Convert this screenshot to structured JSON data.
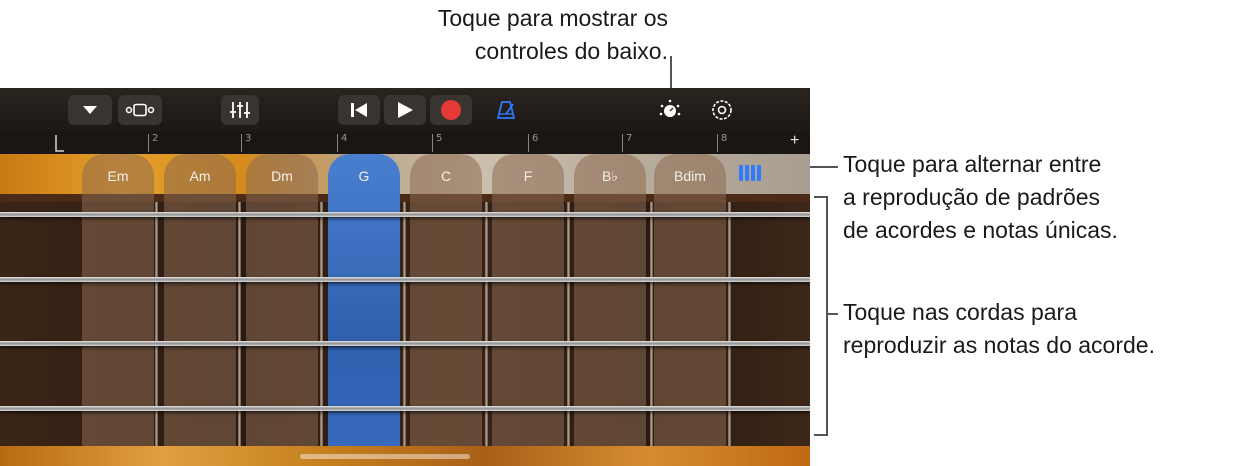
{
  "callouts": {
    "top": [
      "Toque para mostrar os",
      "controles do baixo."
    ],
    "mode": [
      "Toque para alternar entre",
      "a reprodução de padrões",
      "de acordes e notas únicas."
    ],
    "strings": [
      "Toque nas cordas para",
      "reproduzir as notas do acorde."
    ]
  },
  "toolbar": {
    "icons": [
      "dropdown-icon",
      "view-toggle-icon",
      "mixer-icon",
      "go-to-start-icon",
      "play-icon",
      "record-icon",
      "metronome-icon",
      "controls-knob-icon",
      "settings-icon"
    ],
    "accent": "#2f7bff",
    "record_color": "#e53935"
  },
  "ruler": {
    "bars": [
      "2",
      "3",
      "4",
      "5",
      "6",
      "7",
      "8"
    ],
    "add": "+"
  },
  "chords": [
    "Em",
    "Am",
    "Dm",
    "G",
    "C",
    "F",
    "B♭",
    "Bdim"
  ],
  "selected_chord": "G"
}
